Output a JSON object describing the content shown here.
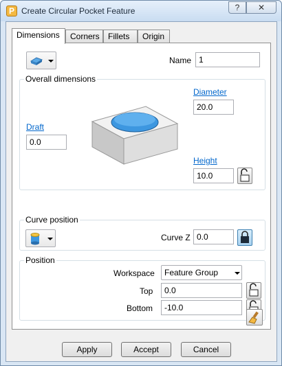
{
  "window": {
    "title": "Create Circular Pocket Feature",
    "app_icon_letter": "P",
    "help_label": "?",
    "close_label": "✕"
  },
  "tabs": [
    {
      "label": "Dimensions",
      "active": true
    },
    {
      "label": "Corners"
    },
    {
      "label": "Fillets"
    },
    {
      "label": "Origin"
    }
  ],
  "name": {
    "label": "Name",
    "value": "1"
  },
  "overall": {
    "title": "Overall dimensions",
    "diameter": {
      "label": "Diameter",
      "value": "20.0"
    },
    "draft": {
      "label": "Draft",
      "value": "0.0"
    },
    "height": {
      "label": "Height",
      "value": "10.0"
    }
  },
  "curve": {
    "title": "Curve position",
    "curvez": {
      "label": "Curve Z",
      "value": "0.0"
    }
  },
  "position": {
    "title": "Position",
    "workspace": {
      "label": "Workspace",
      "value": "Feature Group"
    },
    "top": {
      "label": "Top",
      "value": "0.0"
    },
    "bottom": {
      "label": "Bottom",
      "value": "-10.0"
    }
  },
  "buttons": {
    "apply": "Apply",
    "accept": "Accept",
    "cancel": "Cancel"
  },
  "colors": {
    "accent_link": "#0066cc",
    "pocket_blue": "#3d97e0"
  }
}
